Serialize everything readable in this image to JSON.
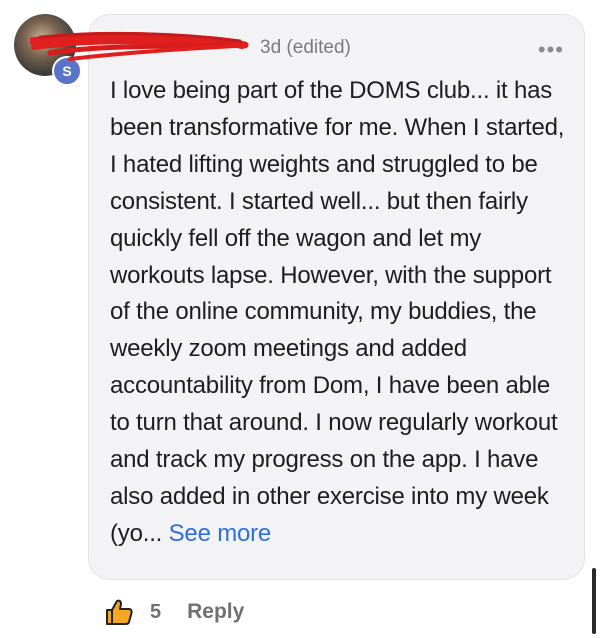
{
  "comment": {
    "avatar_badge": "S",
    "timestamp": "3d",
    "edited": "(edited)",
    "more_icon": "more-horizontal-icon",
    "text": "I love being part of the DOMS club... it has been transformative for me. When I started, I hated lifting weights and struggled to be consistent. I started well... but then fairly quickly fell off the wagon and let my workouts lapse. However, with the support of the online community, my buddies, the weekly zoom meetings and added accountability from Dom, I have been able to turn that around. I now regularly workout and track my progress on the app. I have also added in other exercise into my week (yo...",
    "see_more": "See more"
  },
  "actions": {
    "like_icon": "thumbs-up-icon",
    "like_count": "5",
    "reply_label": "Reply"
  },
  "colors": {
    "bubble_bg": "#f3f3f5",
    "link": "#2f6fdc",
    "redaction": "#e0201f",
    "like_fill": "#f5a623"
  }
}
